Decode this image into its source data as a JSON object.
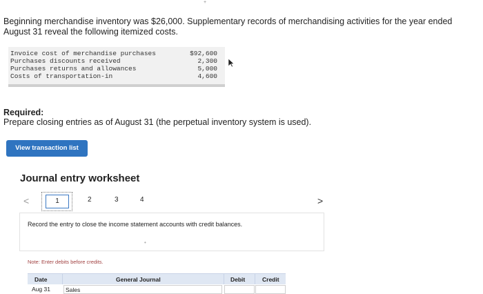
{
  "intro": "Beginning merchandise inventory was $26,000. Supplementary records of merchandising activities for the year ended August 31 reveal the following itemized costs.",
  "costs": [
    {
      "label": "Invoice cost of merchandise purchases",
      "amount": "$92,600"
    },
    {
      "label": "Purchases discounts received",
      "amount": "2,300"
    },
    {
      "label": "Purchases returns and allowances",
      "amount": "5,000"
    },
    {
      "label": "Costs of transportation-in",
      "amount": "4,600"
    }
  ],
  "required": {
    "title": "Required:",
    "text": "Prepare closing entries as of August 31 (the perpetual inventory system is used)."
  },
  "view_transaction_button": "View transaction list",
  "worksheet": {
    "title": "Journal entry worksheet",
    "prev_arrow": "<",
    "next_arrow": ">",
    "steps": [
      "1",
      "2",
      "3",
      "4"
    ],
    "instruction": "Record the entry to close the income statement accounts with credit balances.",
    "note": "Note: Enter debits before credits."
  },
  "table": {
    "headers": {
      "date": "Date",
      "journal": "General Journal",
      "debit": "Debit",
      "credit": "Credit"
    },
    "rows": [
      {
        "date": "Aug 31",
        "account": "Sales",
        "debit": "",
        "credit": ""
      }
    ]
  }
}
